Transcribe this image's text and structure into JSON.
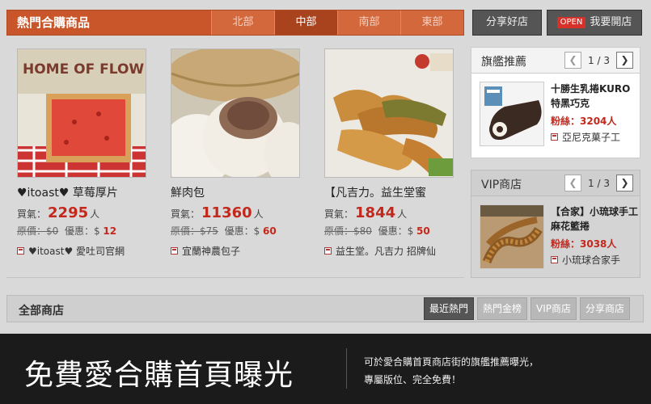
{
  "header": {
    "title": "熱門合購商品",
    "regions": [
      "北部",
      "中部",
      "南部",
      "東部"
    ],
    "active_region": "中部",
    "share_button": "分享好店",
    "open_badge": "OPEN",
    "open_button": "我要開店"
  },
  "products": [
    {
      "name": "♥itoast♥ 草莓厚片",
      "price_label": "買氣：",
      "price": "2295",
      "price_unit": "人",
      "orig_label": "原價：",
      "orig": "$0",
      "disc_label": "優惠：$",
      "disc": "12",
      "store": "♥itoast♥ 愛吐司官網"
    },
    {
      "name": "鮮肉包",
      "price_label": "買氣：",
      "price": "11360",
      "price_unit": "人",
      "orig_label": "原價：",
      "orig": "$75",
      "disc_label": "優惠：$",
      "disc": "60",
      "store": "宜蘭神農包子"
    },
    {
      "name": "【凡吉力。益生堂蜜",
      "price_label": "買氣：",
      "price": "1844",
      "price_unit": "人",
      "orig_label": "原價：",
      "orig": "$80",
      "disc_label": "優惠：$",
      "disc": "50",
      "store": "益生堂。凡吉力 招牌仙"
    }
  ],
  "featured": {
    "title": "旗艦推薦",
    "page": "1 / 3",
    "item_name": "十勝生乳捲KURO特黑巧克",
    "fans": "粉絲：3204人",
    "store": "亞尼克菓子工"
  },
  "vip": {
    "title": "VIP商店",
    "page": "1 / 3",
    "item_name": "【合家】小琉球手工麻花籃捲",
    "fans": "粉絲：3038人",
    "store": "小琉球合家手"
  },
  "all_stores": {
    "title": "全部商店",
    "tabs": [
      "最近熱門",
      "熱門金榜",
      "VIP商店",
      "分享商店"
    ],
    "active_tab": "最近熱門"
  },
  "banner": {
    "headline": "免費愛合購首頁曝光",
    "line1": "可於愛合購首頁商店街的旗艦推薦曝光，",
    "line2": "專屬版位、完全免費！"
  },
  "icons": {
    "prev": "chevron-left-icon",
    "next": "chevron-right-icon",
    "store": "store-icon"
  }
}
